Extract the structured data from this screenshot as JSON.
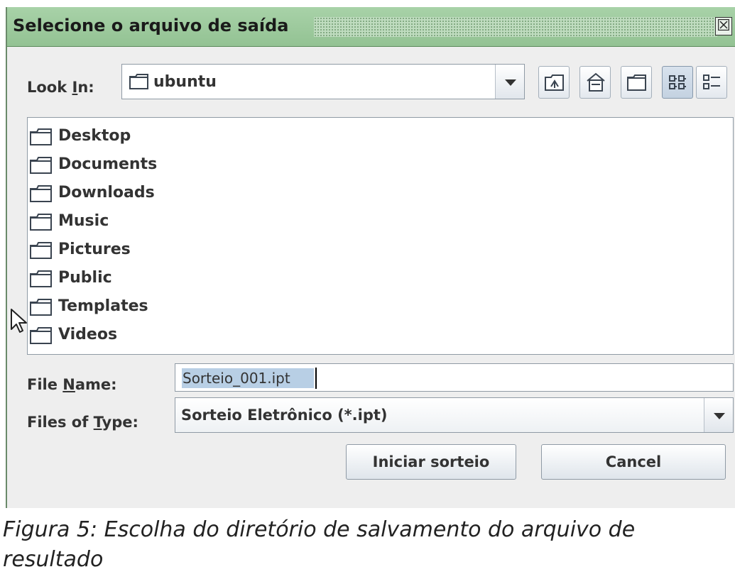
{
  "dialog": {
    "title": "Selecione o arquivo de saída",
    "close_glyph": "☒"
  },
  "look_in": {
    "label": "Look In:",
    "mnemonic": "I",
    "value": "ubuntu"
  },
  "toolbar": {
    "icons": [
      "up-one-level-icon",
      "home-icon",
      "new-folder-icon",
      "list-view-icon",
      "details-view-icon"
    ],
    "active": "list-view-icon"
  },
  "files": [
    {
      "name": "Desktop"
    },
    {
      "name": "Documents"
    },
    {
      "name": "Downloads"
    },
    {
      "name": "Music"
    },
    {
      "name": "Pictures"
    },
    {
      "name": "Public"
    },
    {
      "name": "Templates"
    },
    {
      "name": "Videos"
    }
  ],
  "file_name": {
    "label": "File Name:",
    "mnemonic": "N",
    "value": "Sorteio_001.ipt"
  },
  "files_of_type": {
    "label": "Files of Type:",
    "mnemonic": "T",
    "value": "Sorteio Eletrônico (*.ipt)"
  },
  "buttons": {
    "approve": "Iniciar sorteio",
    "cancel": "Cancel"
  },
  "caption": "Figura 5: Escolha do diretório de salvamento do arquivo de resultado",
  "colors": {
    "title_bar": "#a8d2a8",
    "selection": "#b8cfe5"
  }
}
